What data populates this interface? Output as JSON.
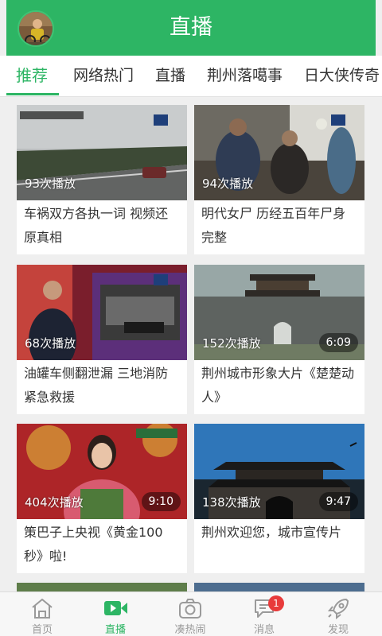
{
  "header": {
    "title": "直播"
  },
  "tabs": [
    {
      "label": "推荐",
      "active": true
    },
    {
      "label": "网络热门"
    },
    {
      "label": "直播"
    },
    {
      "label": "荆州落噶事"
    },
    {
      "label": "日大侠传奇"
    }
  ],
  "videos": [
    {
      "play_count": "93次播放",
      "duration": "",
      "title": "车祸双方各执一词 视频还原真相"
    },
    {
      "play_count": "94次播放",
      "duration": "",
      "title": "明代女尸 历经五百年尸身完整"
    },
    {
      "play_count": "68次播放",
      "duration": "",
      "title": "油罐车侧翻泄漏 三地消防紧急救援"
    },
    {
      "play_count": "152次播放",
      "duration": "6:09",
      "title": "荆州城市形象大片《楚楚动人》"
    },
    {
      "play_count": "404次播放",
      "duration": "9:10",
      "title": "策巴子上央视《黄金100秒》啦!"
    },
    {
      "play_count": "138次播放",
      "duration": "9:47",
      "title": "荆州欢迎您，城市宣传片"
    }
  ],
  "bottom_nav": [
    {
      "label": "首页",
      "icon": "home-icon"
    },
    {
      "label": "直播",
      "icon": "video-icon",
      "active": true
    },
    {
      "label": "凑热闹",
      "icon": "camera-icon"
    },
    {
      "label": "消息",
      "icon": "message-icon",
      "badge": "1"
    },
    {
      "label": "发现",
      "icon": "rocket-icon"
    }
  ],
  "colors": {
    "accent": "#2db564",
    "badge": "#e83b3b",
    "background": "#efefef"
  }
}
